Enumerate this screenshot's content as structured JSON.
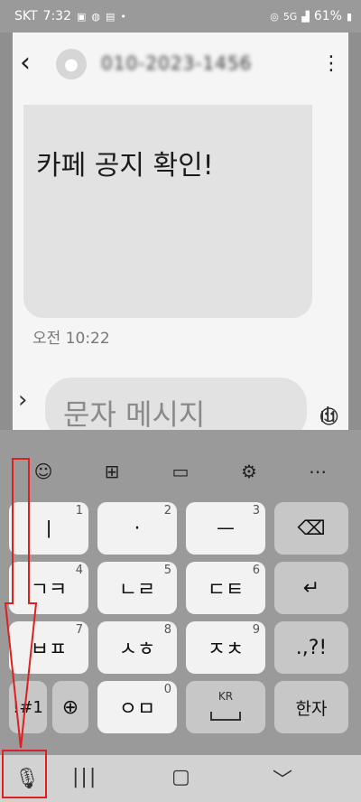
{
  "status": {
    "carrier": "SKT",
    "time": "7:32",
    "battery": "61%",
    "network": "5G"
  },
  "conversation": {
    "back_icon": "back-icon",
    "contact_name": "010-2023-1456",
    "more_icon": "more-vertical-icon"
  },
  "message": {
    "text": "카페 공지 확인!",
    "time": "오전 10:22"
  },
  "composer": {
    "placeholder": "문자 메시지",
    "expand_icon": "chevron-right-icon",
    "emoji_icon": "emoji-icon",
    "voice_icon": "voice-wave-icon"
  },
  "keyboard": {
    "toolbar": [
      "emoji-icon",
      "sticker-icon",
      "clipboard-icon",
      "settings-icon",
      "more-icon"
    ],
    "rows": [
      [
        {
          "label": "ㅣ",
          "num": "1"
        },
        {
          "label": "·",
          "num": "2"
        },
        {
          "label": "ㅡ",
          "num": "3"
        },
        {
          "label": "⌫",
          "num": ""
        }
      ],
      [
        {
          "label": "ㄱㅋ",
          "num": "4"
        },
        {
          "label": "ㄴㄹ",
          "num": "5"
        },
        {
          "label": "ㄷㅌ",
          "num": "6"
        },
        {
          "label": "↵",
          "num": ""
        }
      ],
      [
        {
          "label": "ㅂㅍ",
          "num": "7"
        },
        {
          "label": "ㅅㅎ",
          "num": "8"
        },
        {
          "label": "ㅈㅊ",
          "num": "9"
        },
        {
          "label": ".,?!",
          "num": ""
        }
      ]
    ],
    "bottom": {
      "symbols": "!#1",
      "globe_icon": "globe-icon",
      "zero_key": "ㅇㅁ",
      "zero_num": "0",
      "space_lang": "KR",
      "hanja": "한자"
    }
  },
  "navbar": {
    "mic_icon": "mic-icon",
    "recents_icon": "recents-icon",
    "home_icon": "home-icon",
    "back_icon": "nav-back-icon"
  }
}
